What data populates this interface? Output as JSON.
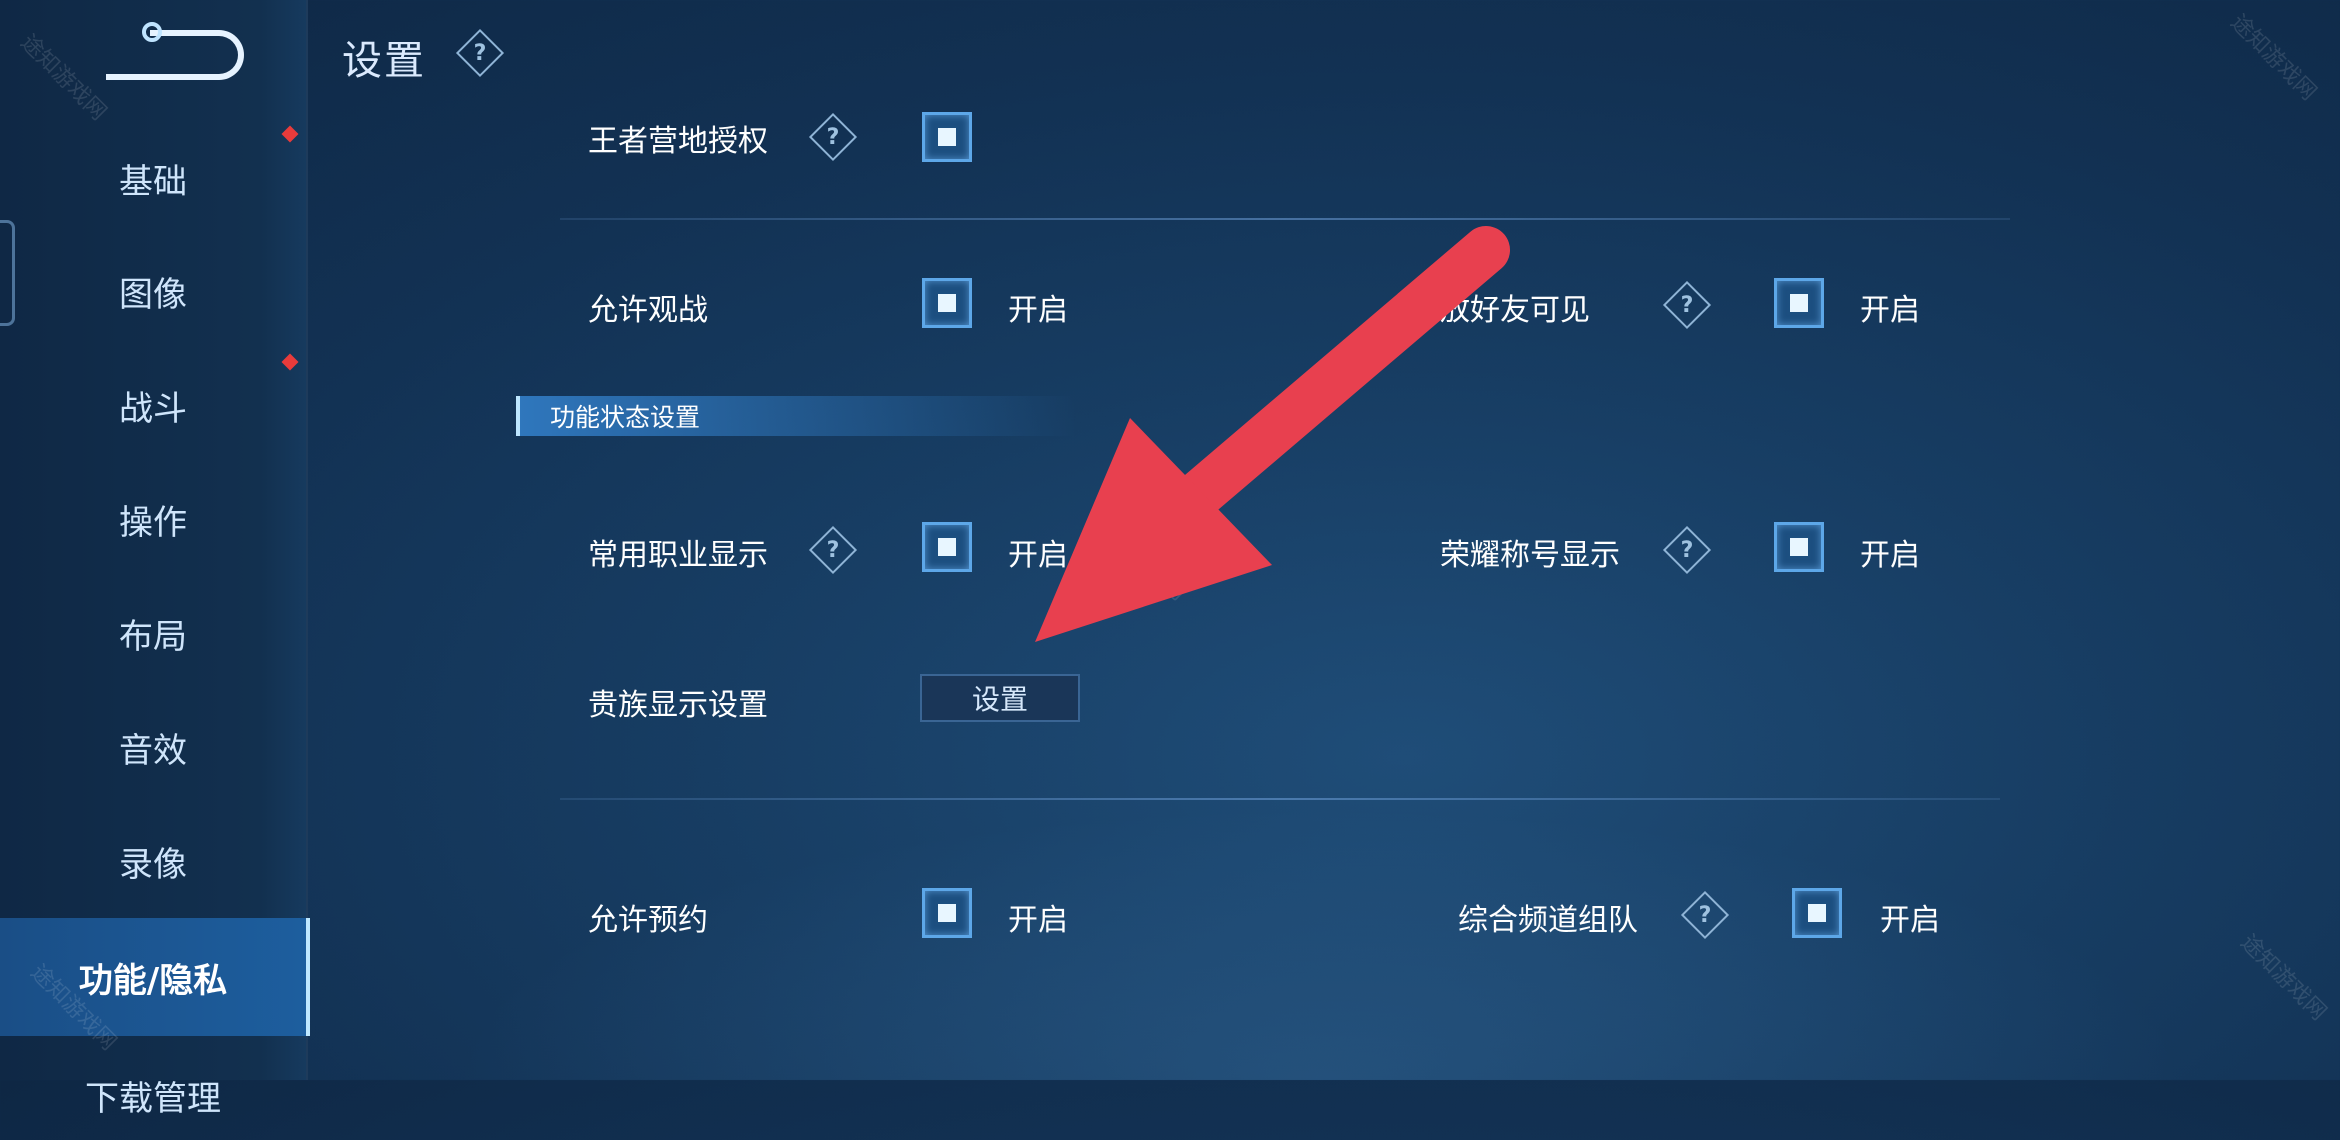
{
  "header": {
    "title": "设置"
  },
  "sidebar": {
    "items": [
      {
        "label": "基础"
      },
      {
        "label": "图像"
      },
      {
        "label": "战斗"
      },
      {
        "label": "操作"
      },
      {
        "label": "布局"
      },
      {
        "label": "音效"
      },
      {
        "label": "录像"
      },
      {
        "label": "功能/隐私"
      },
      {
        "label": "下载管理"
      }
    ],
    "active": "功能/隐私"
  },
  "settings": {
    "camp_auth": {
      "label": "王者营地授权"
    },
    "allow_watch": {
      "label": "允许观战",
      "value": "开启"
    },
    "friends_visible": {
      "label": "放好友可见",
      "value": "开启"
    },
    "section_title": "功能状态设置",
    "common_role": {
      "label": "常用职业显示",
      "value": "开启"
    },
    "honor_title": {
      "label": "荣耀称号显示",
      "value": "开启"
    },
    "noble_display": {
      "label": "贵族显示设置",
      "button": "设置"
    },
    "allow_reserve": {
      "label": "允许预约",
      "value": "开启"
    },
    "channel_team": {
      "label": "综合频道组队",
      "value": "开启"
    }
  },
  "help_icon_glyph": "?",
  "watermark": "途知游戏网",
  "colors": {
    "accent": "#5da7e8",
    "arrow": "#e8404f",
    "badge": "#e83b3b"
  }
}
